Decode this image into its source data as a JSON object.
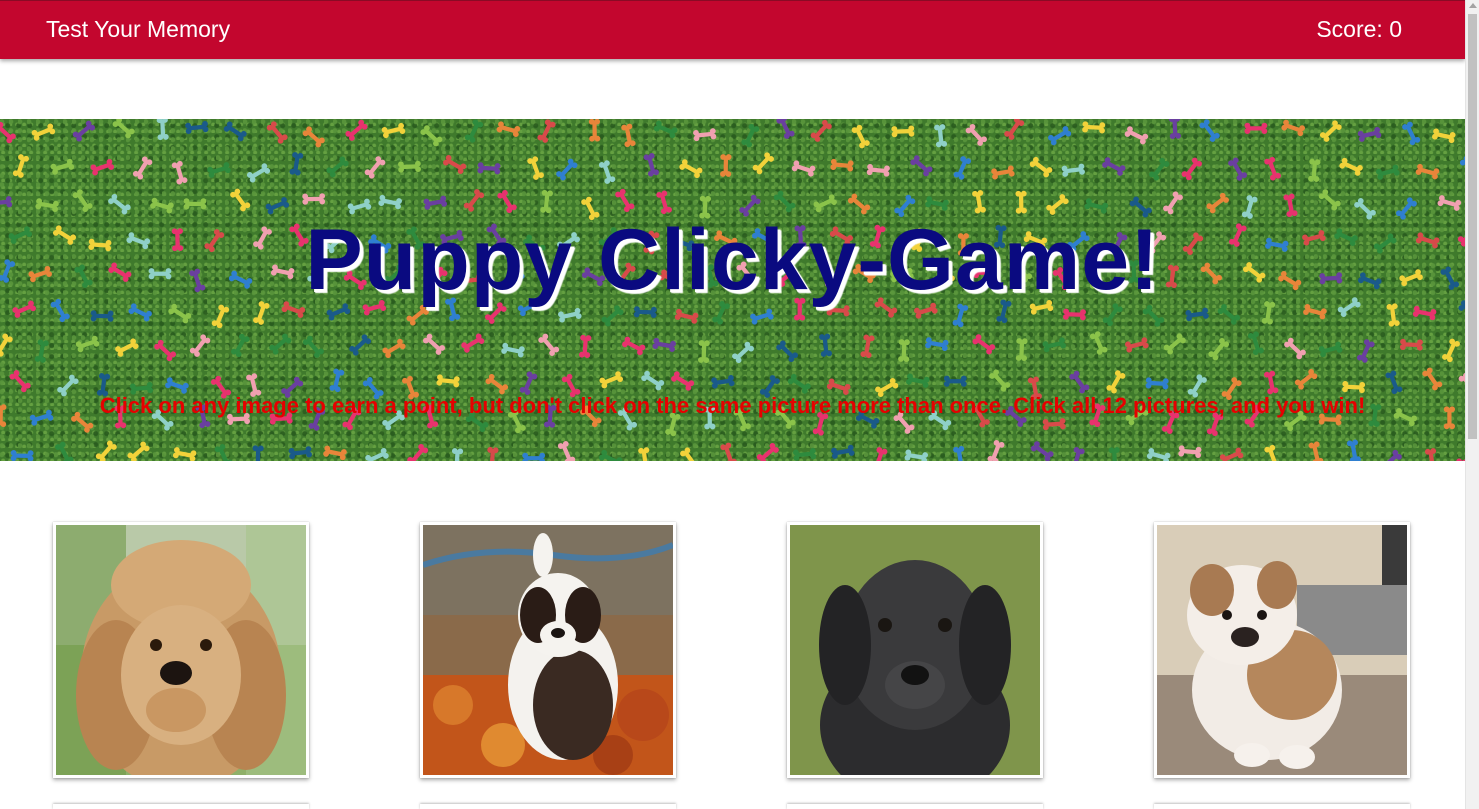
{
  "navbar": {
    "brand": "Test Your Memory",
    "score_label": "Score: 0"
  },
  "hero": {
    "title": "Puppy Clicky-Game!",
    "instructions": "Click on any image to earn a point, but don't click on the same picture more than once. Click all 12 pictures, and you win!"
  },
  "cards": [
    {
      "name": "goldendoodle-puppy"
    },
    {
      "name": "saint-bernard-puppy"
    },
    {
      "name": "black-labrador-puppy"
    },
    {
      "name": "bulldog-puppy"
    }
  ],
  "colors": {
    "navbar": "#c3062e",
    "title": "#0a0a80",
    "instructions": "#e60000",
    "grass": "#3f7a2c"
  }
}
